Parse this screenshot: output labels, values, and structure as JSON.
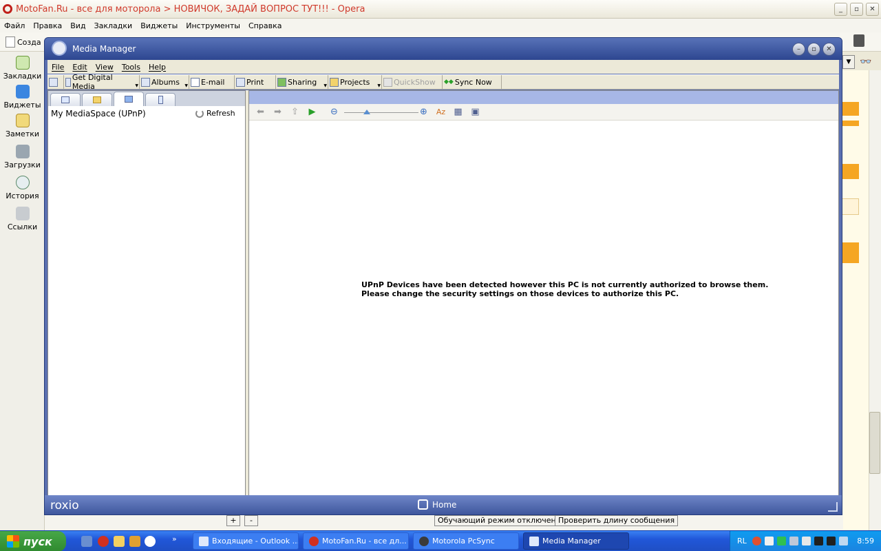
{
  "opera": {
    "title": "MotoFan.Ru - все для моторола > НОВИЧОК, ЗАДАЙ ВОПРОС ТУТ!!! - Opera",
    "menu": [
      "Файл",
      "Правка",
      "Вид",
      "Закладки",
      "Виджеты",
      "Инструменты",
      "Справка"
    ],
    "create_label": "Созда",
    "sidebar": [
      "Закладки",
      "Виджеты",
      "Заметки",
      "Загрузки",
      "История",
      "Ссылки"
    ],
    "bottom_buttons": {
      "plus": "+",
      "minus": "-",
      "tutorial": "Обучающий режим отключен",
      "check_length": "Проверить длину сообщения"
    }
  },
  "media_manager": {
    "title": "Media Manager",
    "menu": [
      "File",
      "Edit",
      "View",
      "Tools",
      "Help"
    ],
    "toolbar": {
      "get_digital_media": "Get Digital Media",
      "albums": "Albums",
      "email": "E-mail",
      "print": "Print",
      "sharing": "Sharing",
      "projects": "Projects",
      "quickshow": "QuickShow",
      "sync_now": "Sync Now"
    },
    "left_pane": {
      "title": "My MediaSpace (UPnP)",
      "refresh": "Refresh"
    },
    "message_line1": "UPnP Devices have been detected however this PC is not currently authorized to browse them.",
    "message_line2": "Please change the security settings on those devices to authorize this PC.",
    "footer": {
      "brand": "roxio",
      "home": "Home"
    }
  },
  "taskbar": {
    "start": "пуск",
    "tasks": [
      "Входящие - Outlook ...",
      "MotoFan.Ru - все дл...",
      "Motorola PcSync",
      "Media Manager"
    ],
    "lang": "RL",
    "clock": "8:59"
  }
}
